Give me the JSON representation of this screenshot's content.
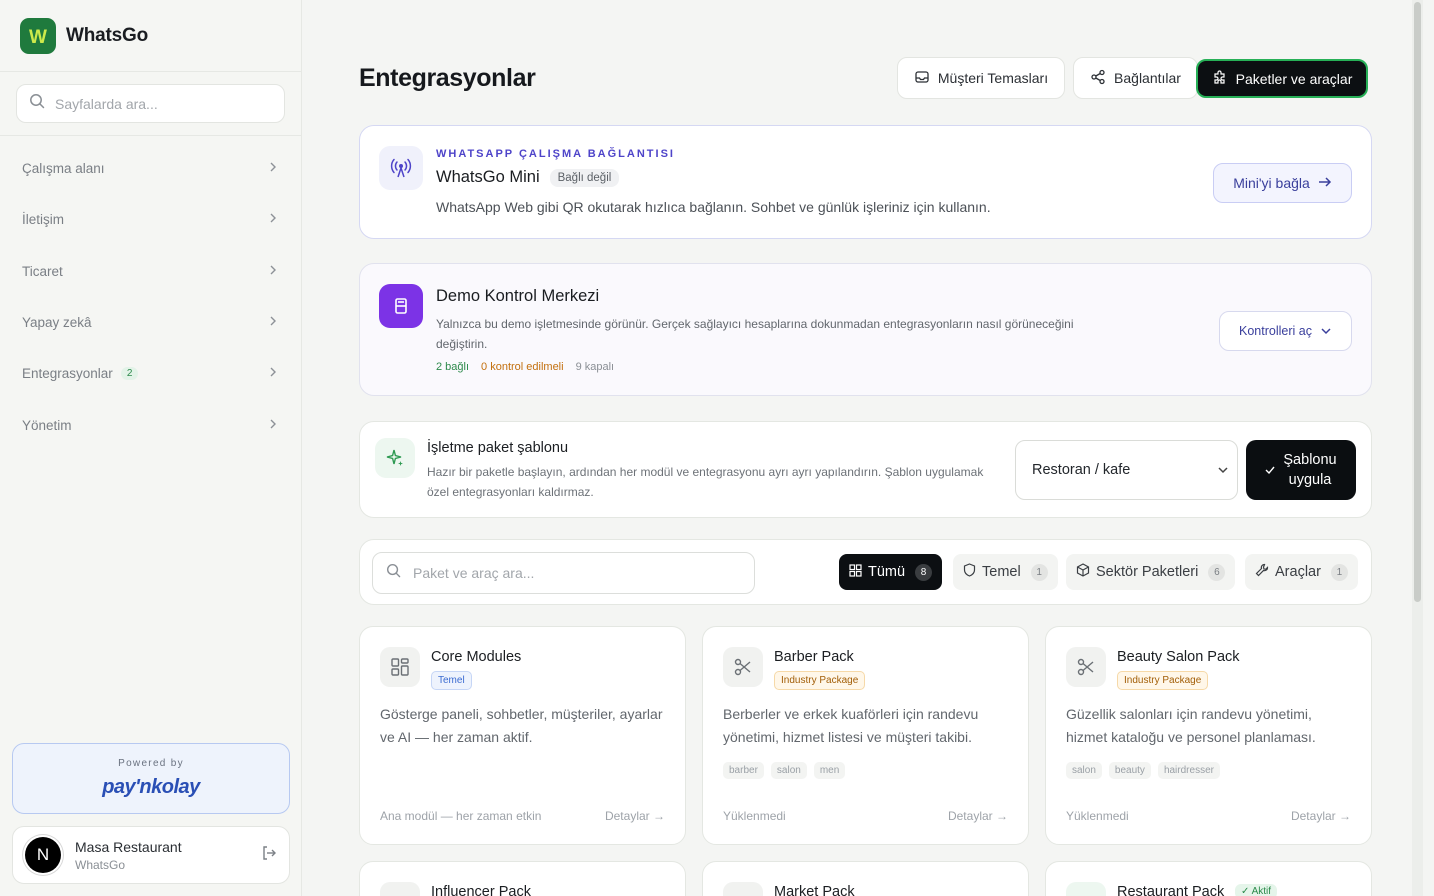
{
  "app": {
    "name": "WhatsGo",
    "logo_letter": "W",
    "accent": "#1f7a3d"
  },
  "sidebar": {
    "search_placeholder": "Sayfalarda ara...",
    "items": [
      {
        "label": "Çalışma alanı"
      },
      {
        "label": "İletişim"
      },
      {
        "label": "Ticaret"
      },
      {
        "label": "Yapay zekâ"
      },
      {
        "label": "Entegrasyonlar",
        "badge": "2"
      },
      {
        "label": "Yönetim"
      }
    ],
    "powered": {
      "label": "Powered by",
      "brand": "pay'nkolay"
    },
    "user": {
      "name": "Masa Restaurant",
      "sub": "WhatsGo",
      "initial": "N"
    }
  },
  "header": {
    "title": "Entegrasyonlar",
    "buttons": [
      {
        "label": "Müşteri Temasları"
      },
      {
        "label": "Bağlantılar"
      },
      {
        "label": "Paketler ve araçlar"
      }
    ]
  },
  "whatsapp": {
    "eyebrow": "WHATSAPP ÇALIŞMA BAĞLANTISI",
    "title": "WhatsGo Mini",
    "status": "Bağlı değil",
    "desc": "WhatsApp Web gibi QR okutarak hızlıca bağlanın. Sohbet ve günlük işleriniz için kullanın.",
    "button": "Mini'yi bağla"
  },
  "demo": {
    "title": "Demo Kontrol Merkezi",
    "desc": "Yalnızca bu demo işletmesinde görünür. Gerçek sağlayıcı hesaplarına dokunmadan entegrasyonların nasıl görüneceğini değiştirin.",
    "stats": {
      "connected": "2 bağlı",
      "check": "0 kontrol edilmeli",
      "closed": "9 kapalı"
    },
    "button": "Kontrolleri aç"
  },
  "template": {
    "title": "İşletme paket şablonu",
    "desc": "Hazır bir paketle başlayın, ardından her modül ve entegrasyonu ayrı ayrı yapılandırın. Şablon uygulamak özel entegrasyonları kaldırmaz.",
    "selected": "Restoran / kafe",
    "apply_line1": "Şablonu",
    "apply_line2": "uygula"
  },
  "filters": {
    "search_placeholder": "Paket ve araç ara...",
    "chips": [
      {
        "label": "Tümü",
        "count": "8"
      },
      {
        "label": "Temel",
        "count": "1"
      },
      {
        "label": "Sektör Paketleri",
        "count": "6"
      },
      {
        "label": "Araçlar",
        "count": "1"
      }
    ]
  },
  "packages": [
    {
      "title": "Core Modules",
      "tag": "Temel",
      "desc": "Gösterge paneli, sohbetler, müşteriler, ayarlar ve AI — her zaman aktif.",
      "keywords": [],
      "status": "Ana modül — her zaman etkin",
      "link": "Detaylar"
    },
    {
      "title": "Barber Pack",
      "tag": "Industry Package",
      "desc": "Berberler ve erkek kuaförleri için randevu yönetimi, hizmet listesi ve müşteri takibi.",
      "keywords": [
        "barber",
        "salon",
        "men"
      ],
      "status": "Yüklenmedi",
      "link": "Detaylar"
    },
    {
      "title": "Beauty Salon Pack",
      "tag": "Industry Package",
      "desc": "Güzellik salonları için randevu yönetimi, hizmet kataloğu ve personel planlaması.",
      "keywords": [
        "salon",
        "beauty",
        "hairdresser"
      ],
      "status": "Yüklenmedi",
      "link": "Detaylar"
    }
  ],
  "packages_peek": [
    {
      "title": "Influencer Pack"
    },
    {
      "title": "Market Pack"
    },
    {
      "title": "Restaurant Pack",
      "badge": "✓ Aktif"
    }
  ]
}
